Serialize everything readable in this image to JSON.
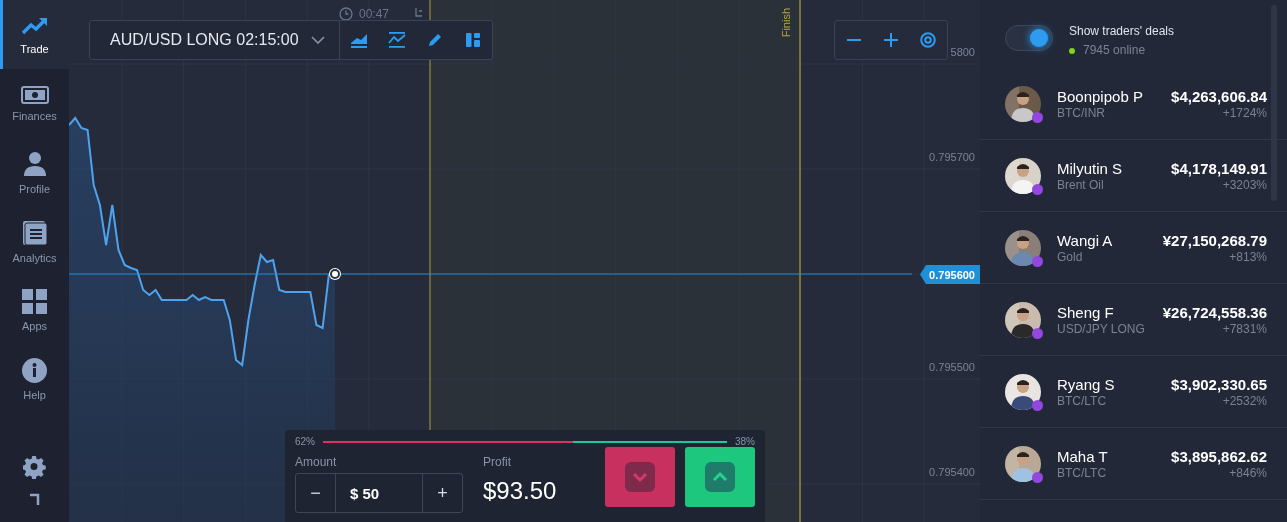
{
  "sidebar": {
    "items": [
      {
        "label": "Trade",
        "selected": true
      },
      {
        "label": "Finances",
        "selected": false
      },
      {
        "label": "Profile",
        "selected": false
      },
      {
        "label": "Analytics",
        "selected": false
      },
      {
        "label": "Apps",
        "selected": false
      },
      {
        "label": "Help",
        "selected": false
      }
    ]
  },
  "toolbar": {
    "asset": "AUD/USD LONG 02:15:00"
  },
  "timer": "00:47",
  "finish_label": "Finish",
  "chart": {
    "current_price": "0.795600",
    "price_labels": [
      "5800",
      "0.795700",
      "0.795500",
      "0.795400"
    ]
  },
  "trade_panel": {
    "down_share": "62%",
    "up_share": "38%",
    "sentiment": {
      "level": 0.62
    },
    "amount_label": "Amount",
    "amount": "$ 50",
    "minus": "−",
    "plus": "+",
    "profit_label": "Profit",
    "profit": "$93.50"
  },
  "traders_panel": {
    "toggle": {
      "label": "Show traders' deals",
      "on": true
    },
    "online": "7945 online",
    "traders": [
      {
        "name": "Boonpipob P",
        "asset": "BTC/INR",
        "amount": "$4,263,606.84",
        "change": "+1724%"
      },
      {
        "name": "Milyutin S",
        "asset": "Brent Oil",
        "amount": "$4,178,149.91",
        "change": "+3203%"
      },
      {
        "name": "Wangi A",
        "asset": "Gold",
        "amount": "¥27,150,268.79",
        "change": "+813%"
      },
      {
        "name": "Sheng F",
        "asset": "USD/JPY LONG",
        "amount": "¥26,724,558.36",
        "change": "+7831%"
      },
      {
        "name": "Ryang S",
        "asset": "BTC/LTC",
        "amount": "$3,902,330.65",
        "change": "+2532%"
      },
      {
        "name": "Maha T",
        "asset": "BTC/LTC",
        "amount": "$3,895,862.62",
        "change": "+846%"
      }
    ]
  }
}
